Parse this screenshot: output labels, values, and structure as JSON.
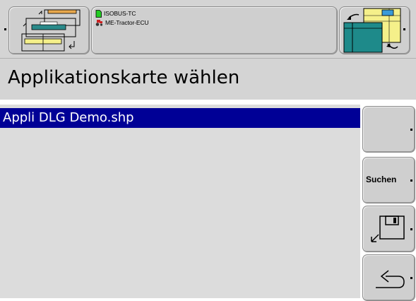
{
  "header": {
    "status_lines": [
      {
        "icon": "document-icon",
        "text": "ISOBUS-TC"
      },
      {
        "icon": "tractor-icon",
        "text": "ME-Tractor-ECU"
      }
    ]
  },
  "page": {
    "title": "Applikationskarte wählen"
  },
  "file_list": {
    "items": [
      {
        "label": "Appli DLG Demo.shp",
        "selected": true
      }
    ]
  },
  "softkeys": [
    {
      "label": "",
      "icon": "blank"
    },
    {
      "label": "Suchen",
      "icon": ""
    },
    {
      "label": "",
      "icon": "save-icon"
    },
    {
      "label": "",
      "icon": "back-arrow-icon"
    }
  ],
  "colors": {
    "selection": "#000096",
    "panel": "#d4d4d4",
    "list_bg": "#dcdcdc"
  }
}
